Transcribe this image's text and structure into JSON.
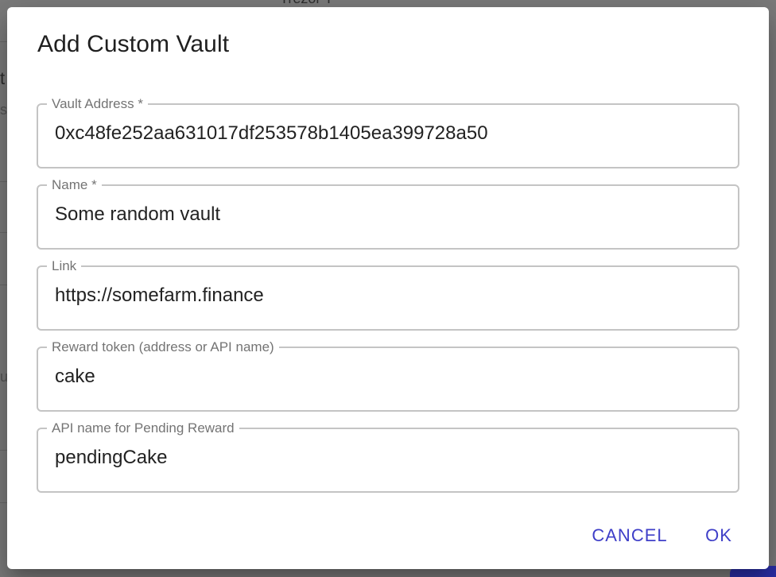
{
  "background": {
    "top_fragment": "Trezor T",
    "t_fragment": "t",
    "s_fragment": "s",
    "u_fragment": "u"
  },
  "dialog": {
    "title": "Add Custom Vault",
    "fields": [
      {
        "label": "Vault Address *",
        "value": "0xc48fe252aa631017df253578b1405ea399728a50"
      },
      {
        "label": "Name *",
        "value": "Some random vault"
      },
      {
        "label": "Link",
        "value": "https://somefarm.finance"
      },
      {
        "label": "Reward token (address or API name)",
        "value": "cake"
      },
      {
        "label": "API name for Pending Reward",
        "value": "pendingCake"
      }
    ],
    "actions": {
      "cancel_label": "CANCEL",
      "ok_label": "OK"
    }
  },
  "colors": {
    "accent": "#3f3fc8",
    "outline": "#c4c4c4",
    "backdrop": "#7b7b7b"
  }
}
